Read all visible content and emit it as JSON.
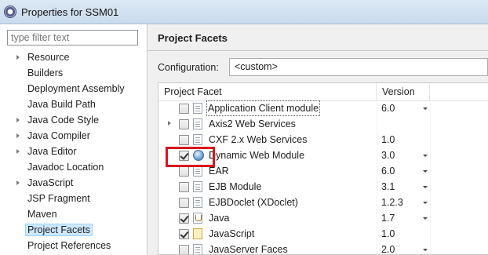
{
  "window": {
    "title": "Properties for SSM01"
  },
  "filter": {
    "placeholder": "type filter text"
  },
  "nav": [
    {
      "label": "Resource",
      "expandable": true
    },
    {
      "label": "Builders",
      "expandable": false
    },
    {
      "label": "Deployment Assembly",
      "expandable": false
    },
    {
      "label": "Java Build Path",
      "expandable": false
    },
    {
      "label": "Java Code Style",
      "expandable": true
    },
    {
      "label": "Java Compiler",
      "expandable": true
    },
    {
      "label": "Java Editor",
      "expandable": true
    },
    {
      "label": "Javadoc Location",
      "expandable": false
    },
    {
      "label": "JavaScript",
      "expandable": true
    },
    {
      "label": "JSP Fragment",
      "expandable": false
    },
    {
      "label": "Maven",
      "expandable": false
    },
    {
      "label": "Project Facets",
      "expandable": false,
      "selected": true
    },
    {
      "label": "Project References",
      "expandable": false
    }
  ],
  "page": {
    "title": "Project Facets",
    "configuration_label": "Configuration:",
    "configuration_value": "<custom>"
  },
  "table": {
    "columns": {
      "facet": "Project Facet",
      "version": "Version"
    },
    "rows": [
      {
        "name": "Application Client module",
        "version": "6.0",
        "checked": false,
        "icon": "doc-icon",
        "dropdown": true,
        "expandable": false
      },
      {
        "name": "Axis2 Web Services",
        "version": "",
        "checked": false,
        "icon": "doc-icon",
        "dropdown": false,
        "expandable": true
      },
      {
        "name": "CXF 2.x Web Services",
        "version": "1.0",
        "checked": false,
        "icon": "doc-icon",
        "dropdown": false,
        "expandable": false
      },
      {
        "name": "Dynamic Web Module",
        "version": "3.0",
        "checked": true,
        "icon": "globe-icon",
        "dropdown": true,
        "expandable": false
      },
      {
        "name": "EAR",
        "version": "6.0",
        "checked": false,
        "icon": "doc-icon",
        "dropdown": true,
        "expandable": false
      },
      {
        "name": "EJB Module",
        "version": "3.1",
        "checked": false,
        "icon": "bean-icon",
        "dropdown": true,
        "expandable": false
      },
      {
        "name": "EJBDoclet (XDoclet)",
        "version": "1.2.3",
        "checked": false,
        "icon": "doc-icon",
        "dropdown": true,
        "expandable": false
      },
      {
        "name": "Java",
        "version": "1.7",
        "checked": true,
        "icon": "java-icon",
        "dropdown": true,
        "expandable": false
      },
      {
        "name": "JavaScript",
        "version": "1.0",
        "checked": true,
        "icon": "js-icon",
        "dropdown": false,
        "expandable": false
      },
      {
        "name": "JavaServer Faces",
        "version": "2.0",
        "checked": false,
        "icon": "doc-icon",
        "dropdown": true,
        "expandable": false
      }
    ]
  },
  "colors": {
    "highlight": "#d9151d",
    "selection": "#cde8ff",
    "titlebar": "#dce8f4"
  }
}
